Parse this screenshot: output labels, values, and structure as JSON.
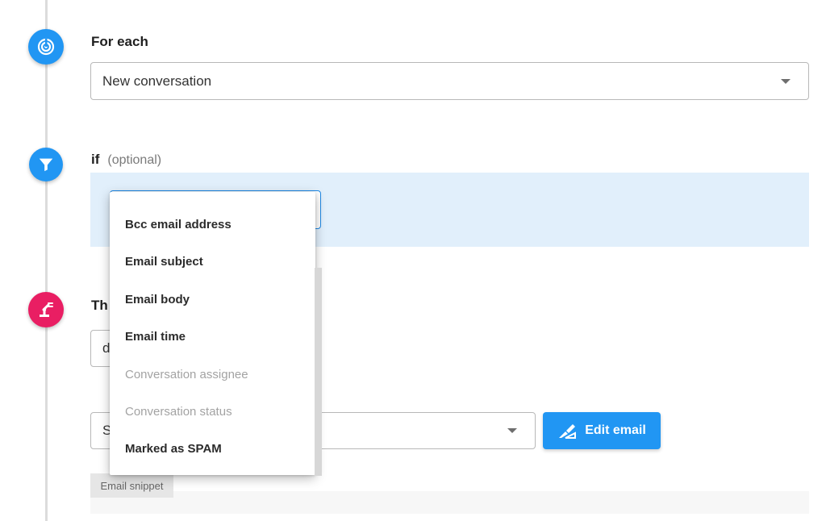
{
  "steps": {
    "trigger": {
      "label": "For each",
      "icon": "radar-icon",
      "color": "#2196f3",
      "select_value": "New conversation"
    },
    "condition": {
      "label": "if",
      "optional": "(optional)",
      "icon": "filter-icon",
      "color": "#2196f3"
    },
    "action": {
      "label_partial": "Th",
      "icon": "robot-arm-icon",
      "color": "#e91e63",
      "field_partial": "d",
      "select_partial": "S"
    }
  },
  "dropdown": {
    "items": [
      {
        "label": "Bcc email address",
        "enabled": true
      },
      {
        "label": "Email subject",
        "enabled": true
      },
      {
        "label": "Email body",
        "enabled": true
      },
      {
        "label": "Email time",
        "enabled": true
      },
      {
        "label": "Conversation assignee",
        "enabled": false
      },
      {
        "label": "Conversation status",
        "enabled": false
      },
      {
        "label": "Marked as SPAM",
        "enabled": true
      }
    ]
  },
  "edit_button": {
    "label": "Edit email",
    "icon": "pen-ruler-icon"
  },
  "snippet": {
    "label": "Email snippet"
  },
  "colors": {
    "accent": "#2196f3",
    "panel": "#e1effb",
    "action": "#e91e63"
  }
}
